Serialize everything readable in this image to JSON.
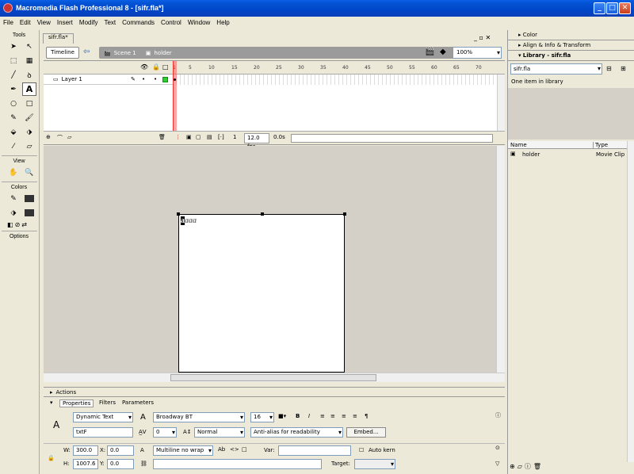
{
  "window": {
    "title": "Macromedia Flash Professional 8 - [sifr.fla*]",
    "minimize": "_",
    "maximize": "□",
    "close": "✕"
  },
  "menu": [
    "File",
    "Edit",
    "View",
    "Insert",
    "Modify",
    "Text",
    "Commands",
    "Control",
    "Window",
    "Help"
  ],
  "tools": {
    "header": "Tools",
    "view_header": "View",
    "colors_header": "Colors",
    "options_header": "Options"
  },
  "document": {
    "tab": "sifr.fla*",
    "timeline_button": "Timeline",
    "scene": "Scene 1",
    "symbol": "holder",
    "zoom": "100%"
  },
  "timeline": {
    "ticks": [
      "1",
      "5",
      "10",
      "15",
      "20",
      "25",
      "30",
      "35",
      "40",
      "45",
      "50",
      "55",
      "60",
      "65",
      "70"
    ],
    "layer_name": "Layer 1",
    "current_frame": "1",
    "fps": "12.0 fps",
    "elapsed": "0.0s"
  },
  "stage": {
    "text_cursor_char": "a",
    "text_rest": "aaa"
  },
  "actions_label": "Actions",
  "properties": {
    "tabs": [
      "Properties",
      "Filters",
      "Parameters"
    ],
    "text_type": "Dynamic Text",
    "instance_name": "txtF",
    "font": "Broadway BT",
    "font_size": "16",
    "letter_spacing": "0",
    "position_mode": "Normal",
    "antialias": "Anti-alias for readability",
    "embed_button": "Embed...",
    "w_label": "W:",
    "w": "300.0",
    "h_label": "H:",
    "h": "1007.6",
    "x_label": "X:",
    "x": "0.0",
    "y_label": "Y:",
    "y": "0.0",
    "line_type": "Multiline no wrap",
    "var_label": "Var:",
    "auto_kern": "Auto kern",
    "target_label": "Target:"
  },
  "panels": {
    "color": "Color",
    "align": "Align & Info & Transform",
    "library": "Library - sifr.fla",
    "library_select": "sifr.fla",
    "library_count": "One item in library",
    "col_name": "Name",
    "col_type": "Type",
    "item_name": "holder",
    "item_type": "Movie Clip"
  }
}
